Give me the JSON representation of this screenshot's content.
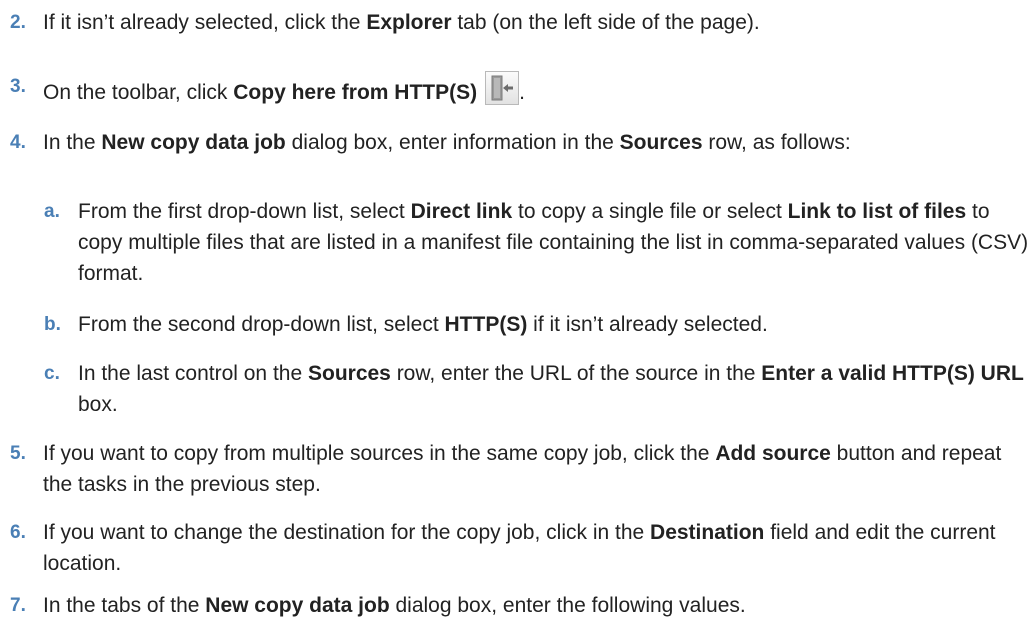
{
  "steps": [
    {
      "num": "2.",
      "parts": [
        "If it isn’t already selected, click the ",
        "Explorer",
        " tab (on the left side of the page)."
      ]
    },
    {
      "num": "3.",
      "parts": [
        "On the toolbar, click ",
        "Copy here from HTTP(S)",
        "",
        "."
      ],
      "icon": "copy-here-from-http-icon"
    },
    {
      "num": "4.",
      "parts": [
        "In the ",
        "New copy data job",
        " dialog box, enter information in the ",
        "Sources",
        " row, as follows:"
      ]
    },
    {
      "num": "5.",
      "parts": [
        "If you want to copy from multiple sources in the same copy job, click the ",
        "Add source",
        " button and repeat the tasks in the previous step."
      ]
    },
    {
      "num": "6.",
      "parts": [
        "If you want to change the destination for the copy job, click in the ",
        "Destination",
        " field and edit the current location."
      ]
    },
    {
      "num": "7.",
      "parts": [
        "In the tabs of the ",
        "New copy data job",
        " dialog box, enter the following values."
      ]
    }
  ],
  "substeps": [
    {
      "num": "a.",
      "parts": [
        "From the first drop-down list, select ",
        "Direct link",
        " to copy a single file or select ",
        "Link to list of files",
        " to copy multiple files that are listed in a manifest file containing the list in comma-separated values (CSV) format."
      ]
    },
    {
      "num": "b.",
      "parts": [
        "From the second drop-down list, select ",
        "HTTP(S)",
        " if it isn’t already selected."
      ]
    },
    {
      "num": "c.",
      "parts": [
        "In the last control on the ",
        "Sources",
        " row, enter the URL of the source in the ",
        "Enter a valid HTTP(S) URL",
        " box."
      ]
    }
  ],
  "colors": {
    "number": "#4a7fb5",
    "text": "#222222"
  }
}
